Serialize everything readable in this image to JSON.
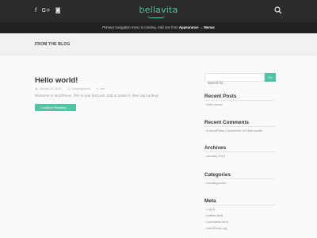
{
  "header": {
    "social_icons": [
      {
        "name": "facebook-icon",
        "glyph": "f"
      },
      {
        "name": "google-plus-icon",
        "glyph": "G+"
      },
      {
        "name": "instagram-icon",
        "glyph": "◙"
      }
    ],
    "logo_text": "bellavita",
    "search_icon": "search-icon"
  },
  "nav": {
    "notice_prefix": "Primary navigation menu is missing. Add one from",
    "notice_link1": "Appearance",
    "notice_arrow": "→",
    "notice_link2": "Menus"
  },
  "blog": {
    "heading": "FROM THE BLOG"
  },
  "post": {
    "title": "Hello world!",
    "date": "January 30, 2019",
    "category": "Uncategorized",
    "author": "alex",
    "excerpt": "Welcome to WordPress. This is your first post. Edit or delete it, then start writing!",
    "continue_label": "Continue Reading →"
  },
  "sidebar": {
    "search_placeholder": "Search for...",
    "search_button": "Go",
    "recent_posts": {
      "title": "Recent Posts",
      "items": [
        "Hello world!"
      ]
    },
    "recent_comments": {
      "title": "Recent Comments",
      "items": [
        "A WordPress Commenter on Hello world!"
      ]
    },
    "archives": {
      "title": "Archives",
      "items": [
        "January 2019"
      ]
    },
    "categories": {
      "title": "Categories",
      "items": [
        "Uncategorized"
      ]
    },
    "meta": {
      "title": "Meta",
      "items": [
        "Log in",
        "Entries feed",
        "Comments feed",
        "WordPress.org"
      ]
    }
  },
  "colors": {
    "accent": "#4ec5a3",
    "topbar": "#2b2b2b"
  }
}
